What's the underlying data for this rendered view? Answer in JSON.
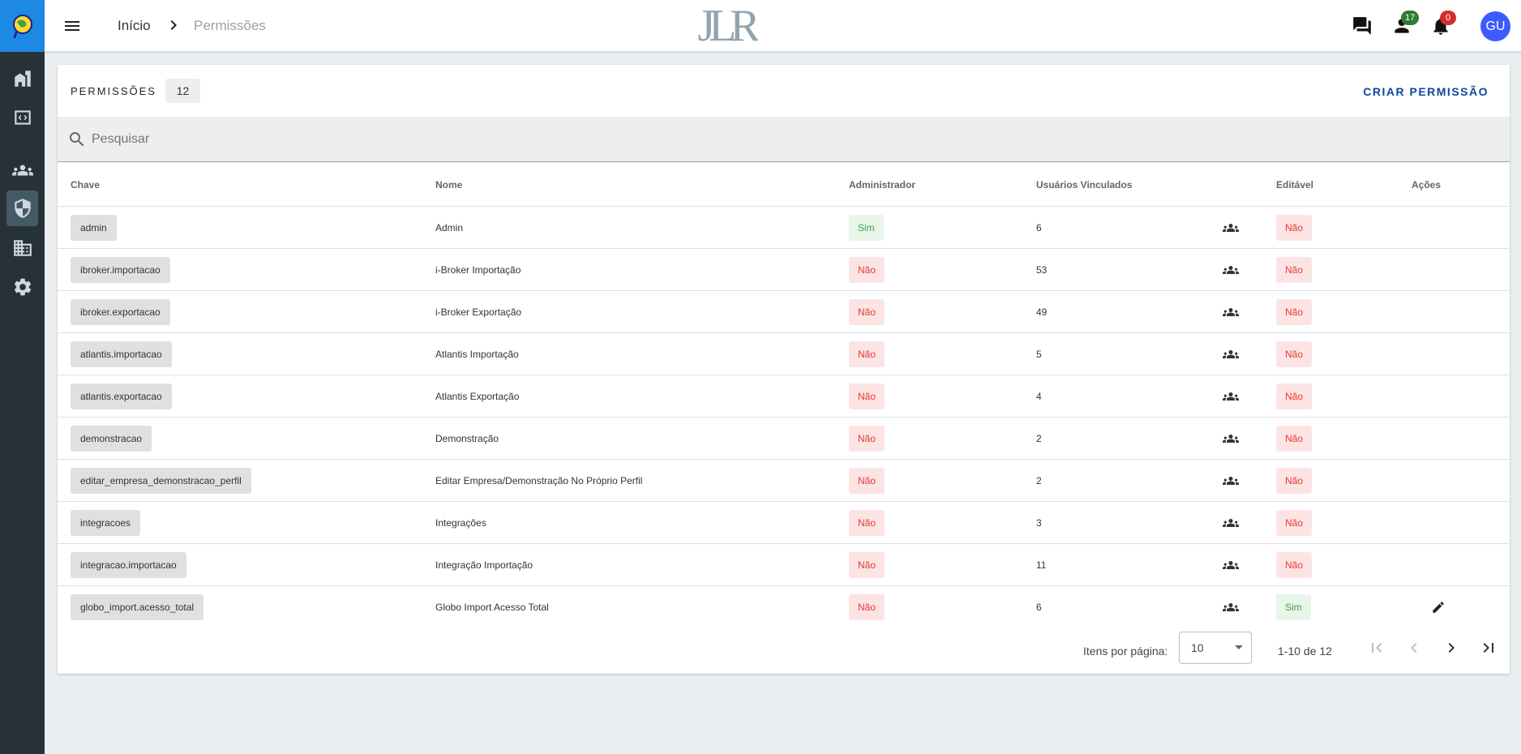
{
  "topbar": {
    "breadcrumb_home": "Início",
    "breadcrumb_current": "Permissões",
    "brand_text": "JLR",
    "contacts_badge": "17",
    "notifications_badge": "0",
    "avatar_initials": "GU"
  },
  "card": {
    "title": "PERMISSÕES",
    "count": "12",
    "create_label": "CRIAR PERMISSÃO"
  },
  "search": {
    "placeholder": "Pesquisar",
    "value": ""
  },
  "table": {
    "headers": {
      "key": "Chave",
      "name": "Nome",
      "admin": "Administrador",
      "users": "Usuários Vinculados",
      "editable": "Editável",
      "actions": "Ações"
    },
    "rows": [
      {
        "key": "admin",
        "name": "Admin",
        "admin": "Sim",
        "users": "6",
        "editable": "Não"
      },
      {
        "key": "ibroker.importacao",
        "name": "i-Broker Importação",
        "admin": "Não",
        "users": "53",
        "editable": "Não"
      },
      {
        "key": "ibroker.exportacao",
        "name": "i-Broker Exportação",
        "admin": "Não",
        "users": "49",
        "editable": "Não"
      },
      {
        "key": "atlantis.importacao",
        "name": "Atlantis Importação",
        "admin": "Não",
        "users": "5",
        "editable": "Não"
      },
      {
        "key": "atlantis.exportacao",
        "name": "Atlantis Exportação",
        "admin": "Não",
        "users": "4",
        "editable": "Não"
      },
      {
        "key": "demonstracao",
        "name": "Demonstração",
        "admin": "Não",
        "users": "2",
        "editable": "Não"
      },
      {
        "key": "editar_empresa_demonstracao_perfil",
        "name": "Editar Empresa/Demonstração No Próprio Perfil",
        "admin": "Não",
        "users": "2",
        "editable": "Não"
      },
      {
        "key": "integracoes",
        "name": "Integrações",
        "admin": "Não",
        "users": "3",
        "editable": "Não"
      },
      {
        "key": "integracao.importacao",
        "name": "Integração Importação",
        "admin": "Não",
        "users": "11",
        "editable": "Não"
      },
      {
        "key": "globo_import.acesso_total",
        "name": "Globo Import Acesso Total",
        "admin": "Não",
        "users": "6",
        "editable": "Sim"
      }
    ]
  },
  "pagination": {
    "items_per_page_label": "Itens por página:",
    "items_per_page_value": "10",
    "range_label": "1-10 de 12"
  },
  "colors": {
    "sidebar": "#263238",
    "logo_bg": "#1e88e5",
    "accent": "#0d47a1",
    "avatar": "#3d5afe",
    "yes_text": "#43a047",
    "no_text": "#e53935"
  }
}
